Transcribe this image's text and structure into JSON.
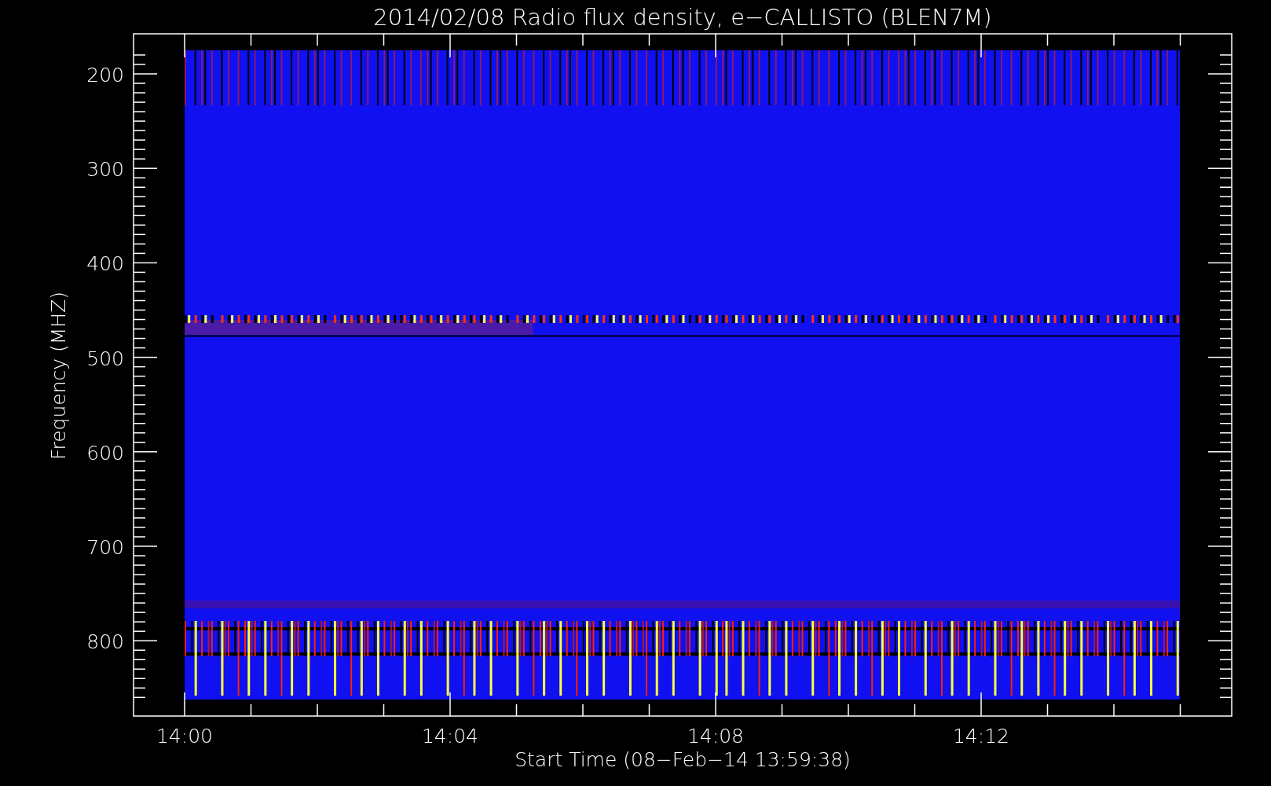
{
  "title": "2014/02/08  Radio flux density, e−CALLISTO (BLEN7M)",
  "y_axis": {
    "label": "Frequency (MHZ)",
    "ticks": [
      "200",
      "300",
      "400",
      "500",
      "600",
      "700",
      "800"
    ]
  },
  "x_axis": {
    "label": "Start Time (08−Feb−14 13:59:38)",
    "ticks": [
      "14:00",
      "14:04",
      "14:08",
      "14:12"
    ]
  }
}
